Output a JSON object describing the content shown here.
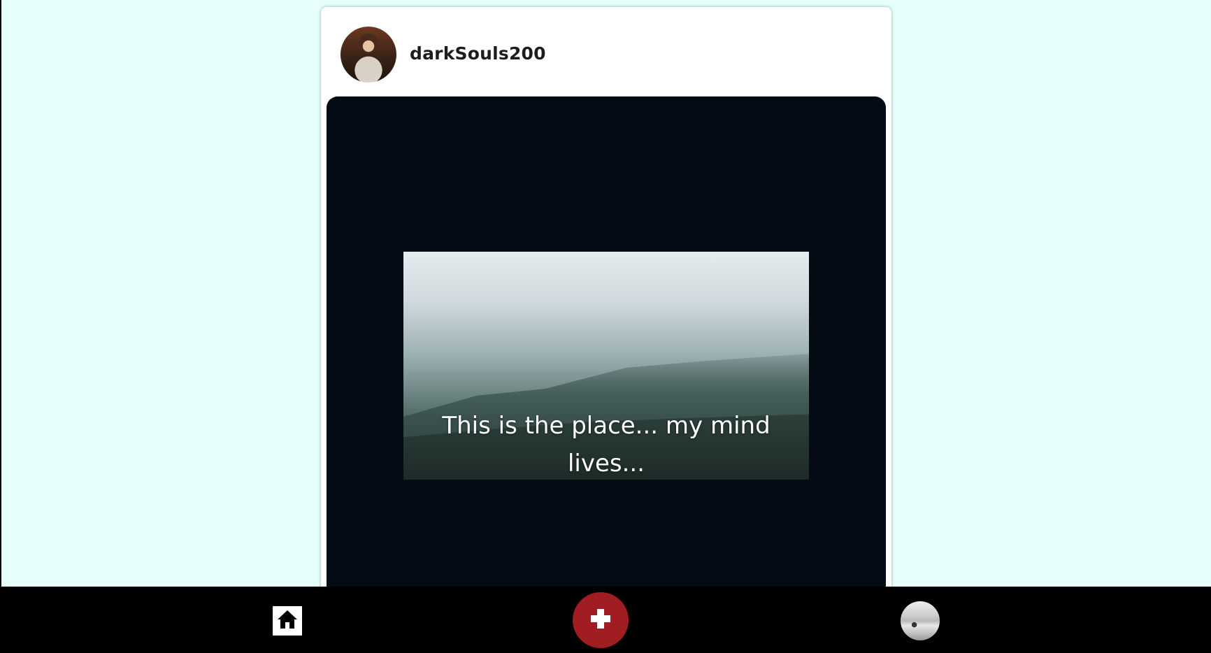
{
  "post": {
    "username": "darkSouls200",
    "caption": "This is the place... my mind lives..."
  },
  "bottom_nav": {
    "home_icon": "home-icon",
    "add_icon": "plus-icon",
    "profile_icon": "avatar"
  },
  "colors": {
    "page_background": "#e6fffb",
    "media_background": "#050b14",
    "nav_background": "#000000",
    "add_button": "#a01d22"
  }
}
